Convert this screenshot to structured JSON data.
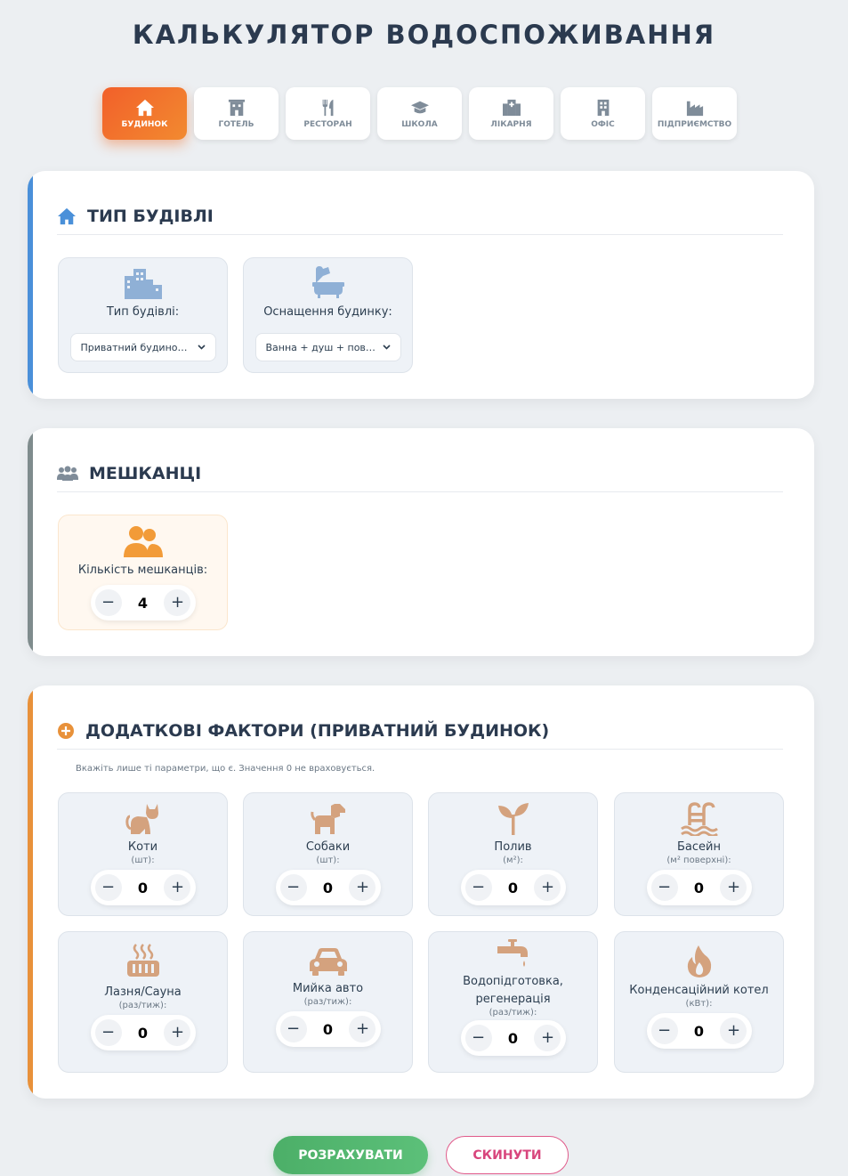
{
  "title": "КАЛЬКУЛЯТОР ВОДОСПОЖИВАННЯ",
  "tabs": [
    {
      "label": "БУДИНОК",
      "icon": "home-icon",
      "active": true
    },
    {
      "label": "ГОТЕЛЬ",
      "icon": "hotel-icon"
    },
    {
      "label": "РЕСТОРАН",
      "icon": "utensils-icon"
    },
    {
      "label": "ШКОЛА",
      "icon": "graduation-cap-icon"
    },
    {
      "label": "ЛІКАРНЯ",
      "icon": "hospital-icon"
    },
    {
      "label": "ОФІС",
      "icon": "office-building-icon"
    },
    {
      "label": "ПІДПРИЄМСТВО",
      "icon": "factory-icon"
    }
  ],
  "building": {
    "heading": "ТИП БУДІВЛІ",
    "accent": "#4a90d9",
    "type_label": "Тип будівлі:",
    "type_value": "Приватний будинок (...",
    "equip_label": "Оснащення будинку:",
    "equip_value": "Ванна + душ + повни..."
  },
  "residents": {
    "heading": "МЕШКАНЦІ",
    "accent": "#7f8c8d",
    "count_label": "Кількість мешканців:",
    "count_value": "4"
  },
  "extras": {
    "heading": "ДОДАТКОВІ ФАКТОРИ (ПРИВАТНИЙ БУДИНОК)",
    "accent": "#e8913a",
    "hint": "Вкажіть лише ті параметри, що є. Значення 0 не враховується.",
    "items": [
      {
        "label": "Коти",
        "unit": "(шт):",
        "value": "0",
        "icon": "cat-icon"
      },
      {
        "label": "Собаки",
        "unit": "(шт):",
        "value": "0",
        "icon": "dog-icon"
      },
      {
        "label": "Полив",
        "unit": "(м²):",
        "value": "0",
        "icon": "seedling-icon"
      },
      {
        "label": "Басейн",
        "unit": "(м² поверхні):",
        "value": "0",
        "icon": "pool-icon"
      },
      {
        "label": "Лазня/Сауна",
        "unit": "(раз/тиж):",
        "value": "0",
        "icon": "sauna-icon"
      },
      {
        "label": "Мийка авто",
        "unit": "(раз/тиж):",
        "value": "0",
        "icon": "car-icon"
      },
      {
        "label": "Водопідготовка, регенерація",
        "unit": "(раз/тиж):",
        "value": "0",
        "icon": "faucet-icon"
      },
      {
        "label": "Конденсаційний котел",
        "unit": "(кВт):",
        "value": "0",
        "icon": "fire-icon"
      }
    ]
  },
  "actions": {
    "calculate": "РОЗРАХУВАТИ",
    "reset": "СКИНУТИ"
  }
}
